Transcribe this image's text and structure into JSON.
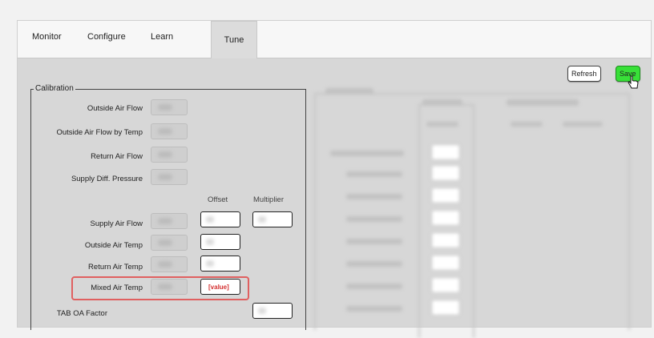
{
  "tabs": [
    {
      "label": "Monitor"
    },
    {
      "label": "Configure"
    },
    {
      "label": "Learn"
    },
    {
      "label": "Tune"
    }
  ],
  "active_tab": "Tune",
  "actions": {
    "refresh": "Refresh",
    "save": "Save"
  },
  "calibration": {
    "legend": "Calibration",
    "rows": [
      {
        "label": "Outside Air Flow"
      },
      {
        "label": "Outside Air Flow by Temp"
      },
      {
        "label": "Return Air Flow"
      },
      {
        "label": "Supply Diff. Pressure"
      }
    ],
    "columns": {
      "offset": "Offset",
      "multiplier": "Multiplier"
    },
    "offset_rows": [
      {
        "label": "Supply Air Flow"
      },
      {
        "label": "Outside Air Temp"
      },
      {
        "label": "Return Air Temp"
      },
      {
        "label": "Mixed Air Temp",
        "offset_value": "[value]"
      },
      {
        "label": "TAB OA Factor"
      }
    ]
  },
  "colors": {
    "highlight": "#e06060",
    "save_bg": "#38e038",
    "panel_bg": "#d7d7d7"
  }
}
